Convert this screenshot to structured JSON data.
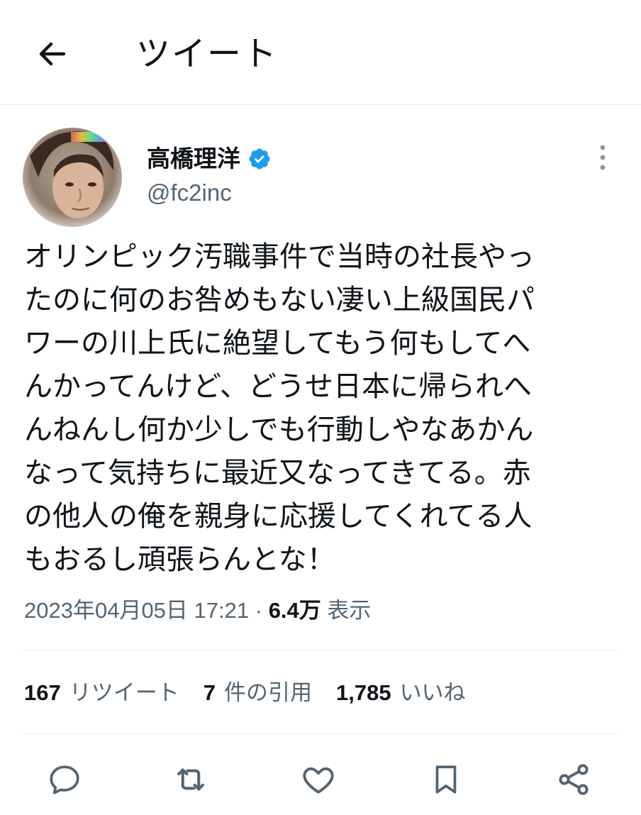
{
  "header": {
    "back_icon": "arrow-left-icon",
    "title": "ツイート"
  },
  "author": {
    "name": "高橋理洋",
    "handle": "@fc2inc",
    "verified_icon": "verified-badge-icon",
    "verified_color": "#1d9bf0",
    "more_icon": "more-vertical-icon"
  },
  "tweet": {
    "lines": [
      "オリンピック汚職事件で当時の社長やっ",
      "たのに何のお咎めもない凄い上級国民パ",
      "ワーの川上氏に絶望してもう何もしてへ",
      "んかってんけど、どうせ日本に帰られへ",
      "んねんし何か少しでも行動しやなあかん",
      "なって気持ちに最近又なってきてる。赤",
      "の他人の俺を親身に応援してくれてる人",
      "もおるし頑張らんとな！"
    ]
  },
  "meta": {
    "datetime": "2023年04月05日 17:21",
    "separator": " · ",
    "views_count": "6.4万",
    "views_label": " 表示"
  },
  "stats": {
    "retweets": {
      "count": "167",
      "label": "リツイート"
    },
    "quotes": {
      "count": "7",
      "label": "件の引用"
    },
    "likes": {
      "count": "1,785",
      "label": "いいね"
    }
  },
  "actions": {
    "reply_icon": "reply-icon",
    "retweet_icon": "retweet-icon",
    "like_icon": "heart-icon",
    "bookmark_icon": "bookmark-icon",
    "share_icon": "share-icon"
  },
  "colors": {
    "text": "#0f1419",
    "secondary": "#536471",
    "divider": "#e6e9eb"
  }
}
